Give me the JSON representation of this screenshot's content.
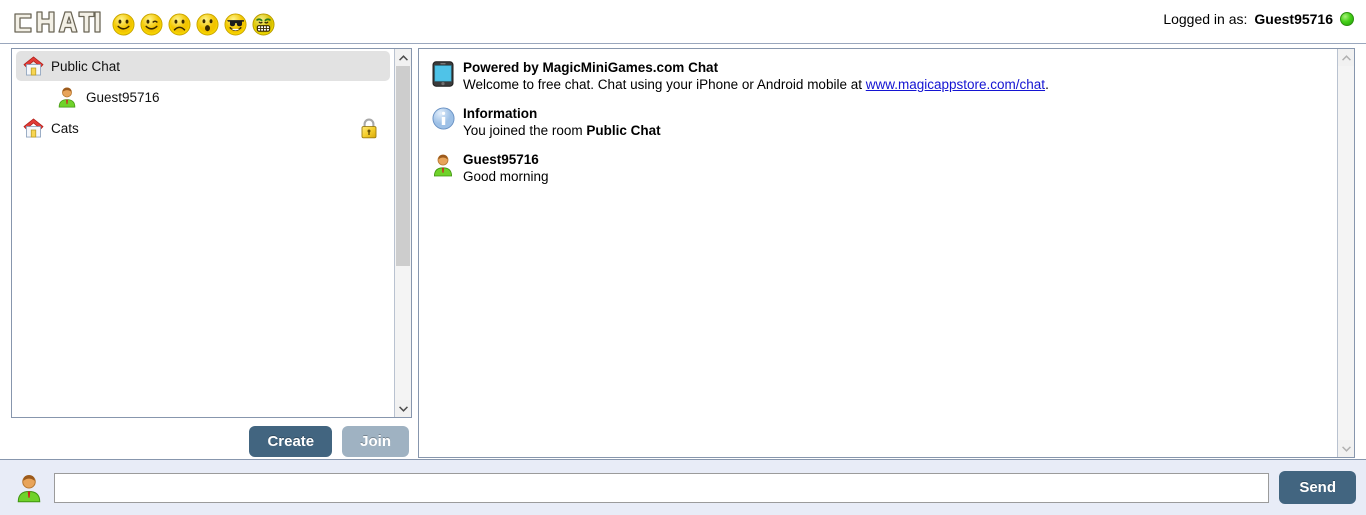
{
  "app": {
    "logo_text": "Chat",
    "accent_color": "#426580",
    "muted_button_color": "#9fb2c2",
    "link_color": "#1414d2",
    "panel_border_color": "#8796ad",
    "composer_background": "#e8ecf7"
  },
  "topbar": {
    "emoticons": [
      {
        "name": "smiley-smile-icon",
        "glyph": "smile"
      },
      {
        "name": "smiley-wink-icon",
        "glyph": "wink"
      },
      {
        "name": "smiley-sad-icon",
        "glyph": "sad"
      },
      {
        "name": "smiley-surprised-icon",
        "glyph": "surprised"
      },
      {
        "name": "smiley-cool-icon",
        "glyph": "cool"
      },
      {
        "name": "smiley-angry-icon",
        "glyph": "angry"
      }
    ],
    "login_label": "Logged in as:",
    "username": "Guest95716",
    "status": "online"
  },
  "rooms": {
    "items": [
      {
        "name": "Public Chat",
        "selected": true,
        "locked": false,
        "icon": "house-icon",
        "members": [
          {
            "name": "Guest95716",
            "icon": "person-icon"
          }
        ]
      },
      {
        "name": "Cats",
        "selected": false,
        "locked": true,
        "icon": "house-icon",
        "members": []
      }
    ],
    "scrollbar": {
      "thumb_top_percent": 0,
      "thumb_height_percent": 60
    }
  },
  "room_actions": {
    "create_label": "Create",
    "join_label": "Join",
    "join_enabled": false
  },
  "chat": {
    "messages": [
      {
        "icon": "phone-icon",
        "title": "Powered by MagicMiniGames.com Chat",
        "text_before": "Welcome to free chat. Chat using your iPhone or Android mobile at ",
        "link_text": "www.magicappstore.com/chat",
        "text_after": "."
      },
      {
        "icon": "info-icon",
        "title": "Information",
        "text_before": "You joined the room ",
        "bold_text": "Public Chat",
        "text_after": ""
      },
      {
        "icon": "person-icon",
        "title": "Guest95716",
        "text_before": "Good morning",
        "bold_text": "",
        "text_after": ""
      }
    ]
  },
  "composer": {
    "avatar": "person-icon",
    "input_value": "",
    "input_placeholder": "",
    "send_label": "Send"
  }
}
